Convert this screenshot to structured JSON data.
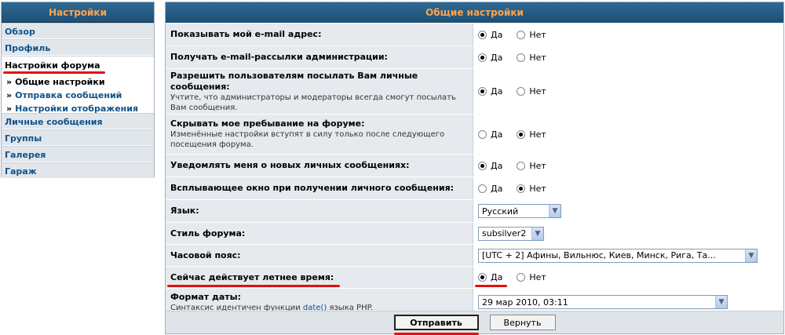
{
  "nav": {
    "title": "Настройки",
    "items_top": [
      "Обзор",
      "Профиль"
    ],
    "active_section": "Настройки форума",
    "sub_items": [
      {
        "label": "Общие настройки",
        "current": true
      },
      {
        "label": "Отправка сообщений",
        "current": false
      },
      {
        "label": "Настройки отображения",
        "current": false
      }
    ],
    "items_bottom": [
      "Личные сообщения",
      "Группы",
      "Галерея",
      "Гараж"
    ],
    "bullet": "»"
  },
  "panel": {
    "title": "Общие настройки",
    "yes": "Да",
    "no": "Нет",
    "rows": [
      {
        "label": "Показывать мой e-mail адрес:",
        "hint": "",
        "choice": "yes"
      },
      {
        "label": "Получать e-mail-рассылки администрации:",
        "hint": "",
        "choice": "yes"
      },
      {
        "label": "Разрешить пользователям посылать Вам личные сообщения:",
        "hint": "Учтите, что администраторы и модераторы всегда смогут посылать Вам сообщения.",
        "choice": "yes"
      },
      {
        "label": "Скрывать мое пребывание на форуме:",
        "hint": "Изменённые настройки вступят в силу только после следующего посещения форума.",
        "choice": "no"
      },
      {
        "label": "Уведомлять меня о новых личных сообщениях:",
        "hint": "",
        "choice": "yes"
      },
      {
        "label": "Всплывающее окно при получении личного сообщения:",
        "hint": "",
        "choice": "no"
      }
    ],
    "language": {
      "label": "Язык:",
      "value": "Русский"
    },
    "style": {
      "label": "Стиль форума:",
      "value": "subsilver2"
    },
    "timezone": {
      "label": "Часовой пояс:",
      "value": "[UTC + 2] Афины, Вильнюс, Киев, Минск, Рига, Та..."
    },
    "dst": {
      "label": "Сейчас действует летнее время:",
      "choice": "yes"
    },
    "date_format": {
      "label": "Формат даты:",
      "hint_prefix": "Синтаксис идентичен функции ",
      "hint_fn": "date()",
      "hint_suffix": " языка PHP.",
      "value": "29 мар 2010, 03:11"
    },
    "submit_label": "Отправить",
    "reset_label": "Вернуть"
  },
  "colors": {
    "header_bg": "#1e4f74",
    "header_text": "#ffa34f",
    "link": "#105289",
    "highlight": "#e30f0f"
  }
}
